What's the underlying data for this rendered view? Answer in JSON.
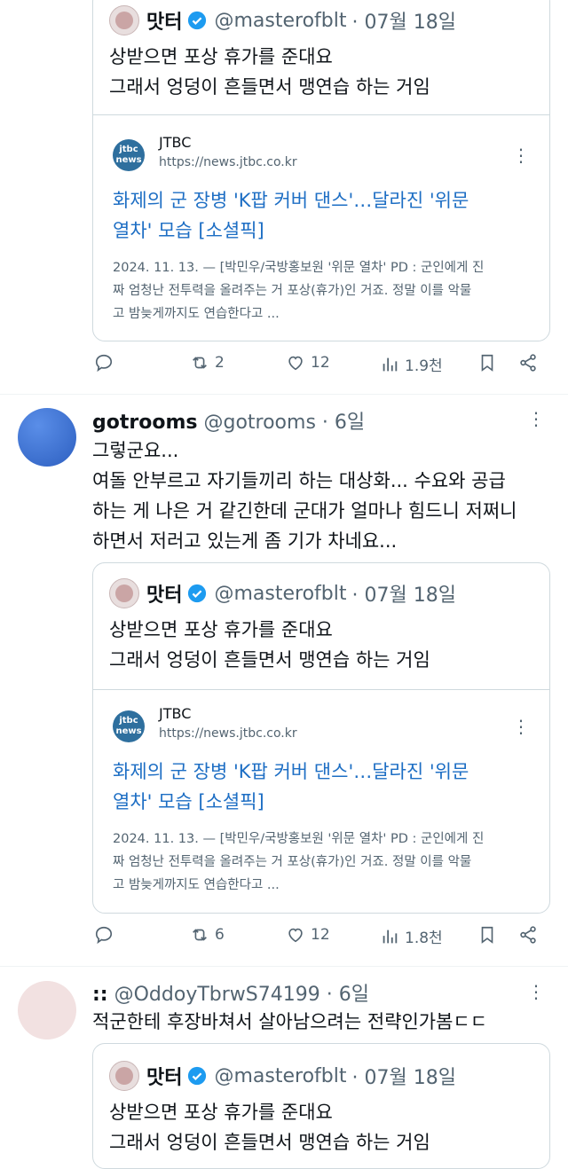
{
  "quote": {
    "name": "맛터",
    "handle": "@masterofblt",
    "date": "· 07월 18일",
    "lines": [
      "상받으면 포상 휴가를 준대요",
      "그래서 엉덩이 흔들면서 맹연습 하는 거임"
    ],
    "source_name": "JTBC",
    "source_url": "https://news.jtbc.co.kr",
    "logo_text": "jtbc news",
    "article_title_1": "화제의 군 장병 'K팝 커버 댄스'…달라진 '위문",
    "article_title_2": "열차' 모습 [소셜픽]",
    "article_desc_1": "2024. 11. 13. — [박민우/국방홍보원 '위문 열차' PD : 군인에게 진",
    "article_desc_2": "짜 엄청난 전투력을 올려주는 거 포상(휴가)인 거죠. 정말 이를 악물",
    "article_desc_3": "고 밤늦게까지도 연습한다고 ..."
  },
  "post1_actions": {
    "reposts": "2",
    "likes": "12",
    "views": "1.9천"
  },
  "post2": {
    "name": "gotrooms",
    "handle": "@gotrooms",
    "date": "· 6일",
    "lines": [
      "그렇군요...",
      "여돌 안부르고 자기들끼리 하는 대상화... 수요와 공급",
      "하는 게 나은 거 같긴한데 군대가 얼마나 힘드니 저쩌니",
      "하면서 저러고 있는게 좀 기가 차네요..."
    ],
    "avatar_color": "#3b74d4"
  },
  "post2_actions": {
    "reposts": "6",
    "likes": "12",
    "views": "1.8천"
  },
  "post3": {
    "name": "::",
    "handle": "@OddoyTbrwS74199",
    "date": "· 6일",
    "text": "적군한테 후장바쳐서 살아남으려는 전략인가봄ㄷㄷ",
    "avatar_color": "#f2e1e1"
  },
  "icons": {
    "reply": "reply-icon",
    "repost": "repost-icon",
    "like": "heart-icon",
    "views": "views-icon",
    "bookmark": "bookmark-icon",
    "share": "share-icon",
    "more": "more-icon",
    "verified": "verified-badge-icon"
  },
  "colors": {
    "link": "#1d6ec4",
    "verified": "#1d9bf0",
    "muted": "#536471"
  }
}
